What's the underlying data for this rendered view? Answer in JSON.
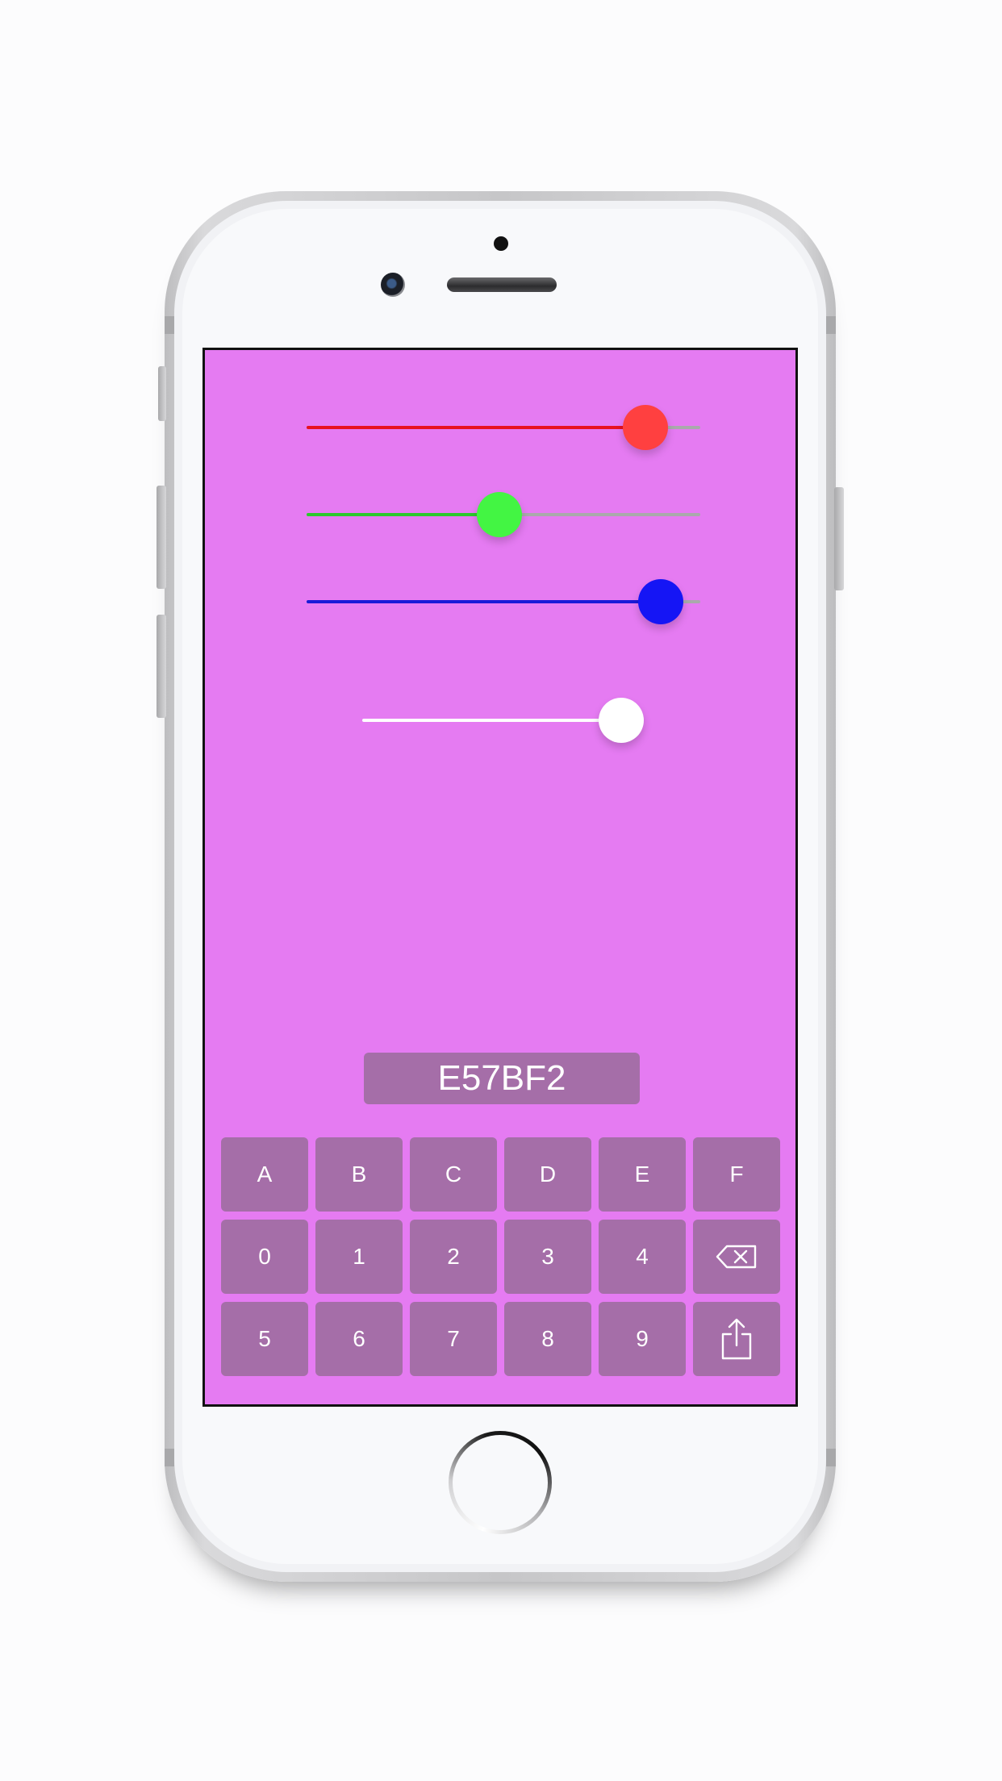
{
  "colors": {
    "screen_background": "#E57BF2",
    "control_background": "#A56EA8",
    "red_slider": "#E8111F",
    "red_thumb": "#FF4040",
    "green_slider": "#2CC92C",
    "green_thumb": "#43F543",
    "blue_slider": "#1A1AD8",
    "blue_thumb": "#1515F5",
    "alpha_slider": "#FFFFFF"
  },
  "sliders": {
    "red": {
      "value": 0.86
    },
    "green": {
      "value": 0.49
    },
    "blue": {
      "value": 0.9
    },
    "alpha": {
      "value": 0.92
    }
  },
  "hex_display": {
    "value": "E57BF2"
  },
  "keypad": {
    "rows": [
      [
        {
          "label": "A",
          "kind": "text"
        },
        {
          "label": "B",
          "kind": "text"
        },
        {
          "label": "C",
          "kind": "text"
        },
        {
          "label": "D",
          "kind": "text"
        },
        {
          "label": "E",
          "kind": "text"
        },
        {
          "label": "F",
          "kind": "text"
        }
      ],
      [
        {
          "label": "0",
          "kind": "text"
        },
        {
          "label": "1",
          "kind": "text"
        },
        {
          "label": "2",
          "kind": "text"
        },
        {
          "label": "3",
          "kind": "text"
        },
        {
          "label": "4",
          "kind": "text"
        },
        {
          "label": "",
          "kind": "icon",
          "icon": "backspace-icon"
        }
      ],
      [
        {
          "label": "5",
          "kind": "text"
        },
        {
          "label": "6",
          "kind": "text"
        },
        {
          "label": "7",
          "kind": "text"
        },
        {
          "label": "8",
          "kind": "text"
        },
        {
          "label": "9",
          "kind": "text"
        },
        {
          "label": "",
          "kind": "icon",
          "icon": "share-icon"
        }
      ]
    ]
  }
}
